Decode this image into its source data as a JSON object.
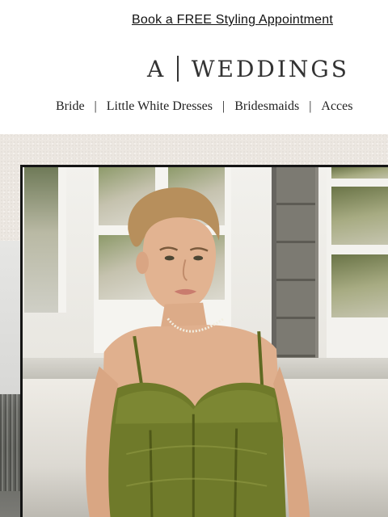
{
  "promo": {
    "text": "Book a FREE Styling Appointment"
  },
  "logo": {
    "letter": "A",
    "name": "WEDDINGS"
  },
  "nav": {
    "items": [
      {
        "label": "Bride"
      },
      {
        "label": "Little White Dresses"
      },
      {
        "label": "Bridesmaids"
      },
      {
        "label": "Acces"
      }
    ],
    "separator": "|"
  },
  "hero": {
    "image_subject": "model in olive green lace corset dress"
  },
  "colors": {
    "background": "#ffffff",
    "hero_background": "#ece7e1",
    "dress_green": "#6f7a2a",
    "text": "#1a1a1a"
  }
}
